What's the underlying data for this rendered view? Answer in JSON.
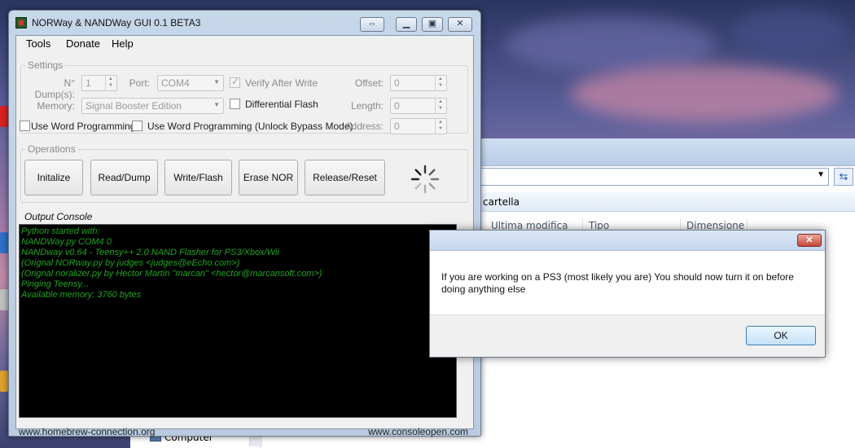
{
  "app": {
    "title": "NORWay & NANDWay GUI 0.1 BETA3",
    "menu": [
      "Tools",
      "Donate",
      "Help"
    ]
  },
  "settings": {
    "group_label": "Settings",
    "n_dump_label": "N° Dump(s):",
    "n_dump_value": "1",
    "port_label": "Port:",
    "port_value": "COM4",
    "verify_label": "Verify After Write",
    "verify_checked": true,
    "offset_label": "Offset:",
    "offset_value": "0",
    "memory_label": "Memory:",
    "memory_value": "Signal Booster Edition",
    "differential_label": "Differential Flash",
    "length_label": "Length:",
    "length_value": "0",
    "word_prog_label": "Use Word Programming",
    "word_prog_unlock_label": "Use Word Programming (Unlock Bypass Mode)",
    "address_label": "Address:",
    "address_value": "0"
  },
  "operations": {
    "group_label": "Operations",
    "buttons": [
      "Initalize",
      "Read/Dump",
      "Write/Flash",
      "Erase NOR",
      "Release/Reset"
    ]
  },
  "console": {
    "label": "Output Console",
    "lines": [
      "Python started with:",
      "NANDWay.py COM4 0",
      "NANDway v0.64 - Teensy++ 2.0 NAND Flasher for PS3/Xbox/Wii",
      "(Orignal NORway.py by judges <judges@eEcho.com>)",
      "(Orignal noralizer.py by Hector Martin \"marcan\" <hector@marcansoft.com>)",
      "Pinging Teensy...",
      "Available memory: 3760 bytes"
    ]
  },
  "footer": {
    "left": "www.homebrew-connection.org",
    "right": "www.consoleopen.com"
  },
  "dialog": {
    "message": "If you are working on a PS3 (most likely you are) You should now turn it on before doing anything else",
    "ok_label": "OK"
  },
  "explorer": {
    "folder_cmd": "cartella",
    "columns": [
      "Ultima modifica",
      "Tipo",
      "Dimensione"
    ],
    "nav_item": "Computer"
  },
  "colors": {
    "console_bg": "#000000",
    "console_text": "#1ea51e",
    "titlebar": "#c7d7ea",
    "close_button": "#c6473a"
  }
}
